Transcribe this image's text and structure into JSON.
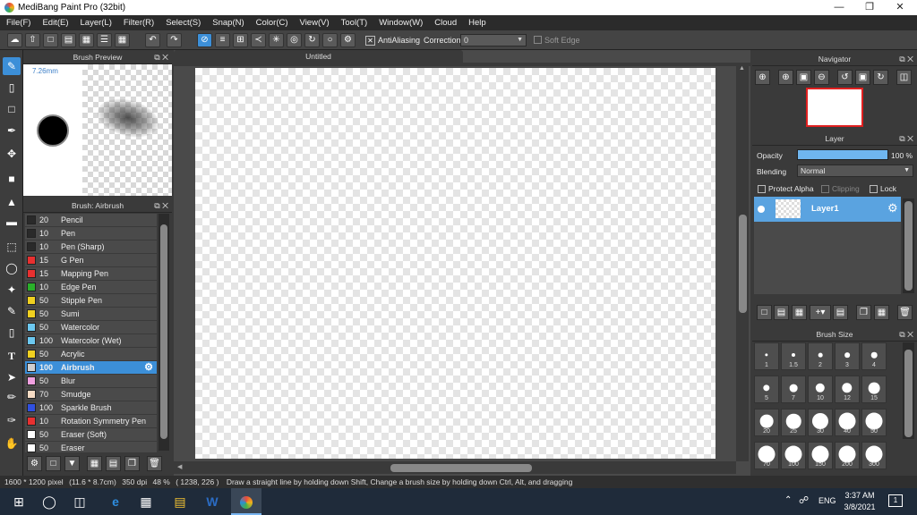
{
  "app": {
    "title": "MediBang Paint Pro (32bit)"
  },
  "menu": [
    "File(F)",
    "Edit(E)",
    "Layer(L)",
    "Filter(R)",
    "Select(S)",
    "Snap(N)",
    "Color(C)",
    "View(V)",
    "Tool(T)",
    "Window(W)",
    "Cloud",
    "Help"
  ],
  "toolbar": {
    "antialiasing_label": "AntiAliasing",
    "correction_label": "Correction",
    "correction_value": "0",
    "soft_edge_label": "Soft Edge"
  },
  "brush_preview": {
    "title": "Brush Preview",
    "size_text": "7.26mm"
  },
  "brush_panel": {
    "title": "Brush: Airbrush",
    "items": [
      {
        "size": "20",
        "name": "Pencil",
        "color": "#2a2a2a"
      },
      {
        "size": "10",
        "name": "Pen",
        "color": "#2a2a2a"
      },
      {
        "size": "10",
        "name": "Pen (Sharp)",
        "color": "#2a2a2a"
      },
      {
        "size": "15",
        "name": "G Pen",
        "color": "#e83030"
      },
      {
        "size": "15",
        "name": "Mapping Pen",
        "color": "#e83030"
      },
      {
        "size": "10",
        "name": "Edge Pen",
        "color": "#2ab02a"
      },
      {
        "size": "50",
        "name": "Stipple Pen",
        "color": "#f0d020"
      },
      {
        "size": "50",
        "name": "Sumi",
        "color": "#f0d020"
      },
      {
        "size": "50",
        "name": "Watercolor",
        "color": "#6cc8f0"
      },
      {
        "size": "100",
        "name": "Watercolor (Wet)",
        "color": "#6cc8f0"
      },
      {
        "size": "50",
        "name": "Acrylic",
        "color": "#f0d020"
      },
      {
        "size": "100",
        "name": "Airbrush",
        "color": "#cfcfcf"
      },
      {
        "size": "50",
        "name": "Blur",
        "color": "#f0a0e0"
      },
      {
        "size": "70",
        "name": "Smudge",
        "color": "#f7dcc4"
      },
      {
        "size": "100",
        "name": "Sparkle Brush",
        "color": "#3050e0"
      },
      {
        "size": "10",
        "name": "Rotation Symmetry Pen",
        "color": "#e83030"
      },
      {
        "size": "50",
        "name": "Eraser (Soft)",
        "color": "#ffffff"
      },
      {
        "size": "50",
        "name": "Eraser",
        "color": "#ffffff"
      }
    ],
    "selected_index": 11
  },
  "document": {
    "tab_title": "Untitled"
  },
  "navigator": {
    "title": "Navigator"
  },
  "layer_panel": {
    "title": "Layer",
    "opacity_label": "Opacity",
    "opacity_value": "100 %",
    "opacity_fraction": 1.0,
    "blending_label": "Blending",
    "blending_value": "Normal",
    "protect_alpha": "Protect Alpha",
    "clipping": "Clipping",
    "lock": "Lock",
    "layers": [
      {
        "name": "Layer1"
      }
    ]
  },
  "brush_size": {
    "title": "Brush Size",
    "sizes": [
      "1",
      "1.5",
      "2",
      "3",
      "4",
      "5",
      "7",
      "10",
      "12",
      "15",
      "20",
      "25",
      "30",
      "40",
      "50",
      "70",
      "100",
      "150",
      "200",
      "300"
    ]
  },
  "status": {
    "dimensions": "1600 * 1200 pixel",
    "physical": "(11.6 * 8.7cm)",
    "dpi": "350 dpi",
    "zoom": "48 %",
    "coords": "( 1238, 226 )",
    "hint": "Draw a straight line by holding down Shift, Change a brush size by holding down Ctrl, Alt, and dragging"
  },
  "taskbar": {
    "language": "ENG",
    "time": "3:37 AM",
    "date": "3/8/2021",
    "notif_count": "1"
  },
  "colors": {
    "accent": "#3c8fd8",
    "panel": "#3a3a3a",
    "taskbar": "#1f2b3a"
  }
}
